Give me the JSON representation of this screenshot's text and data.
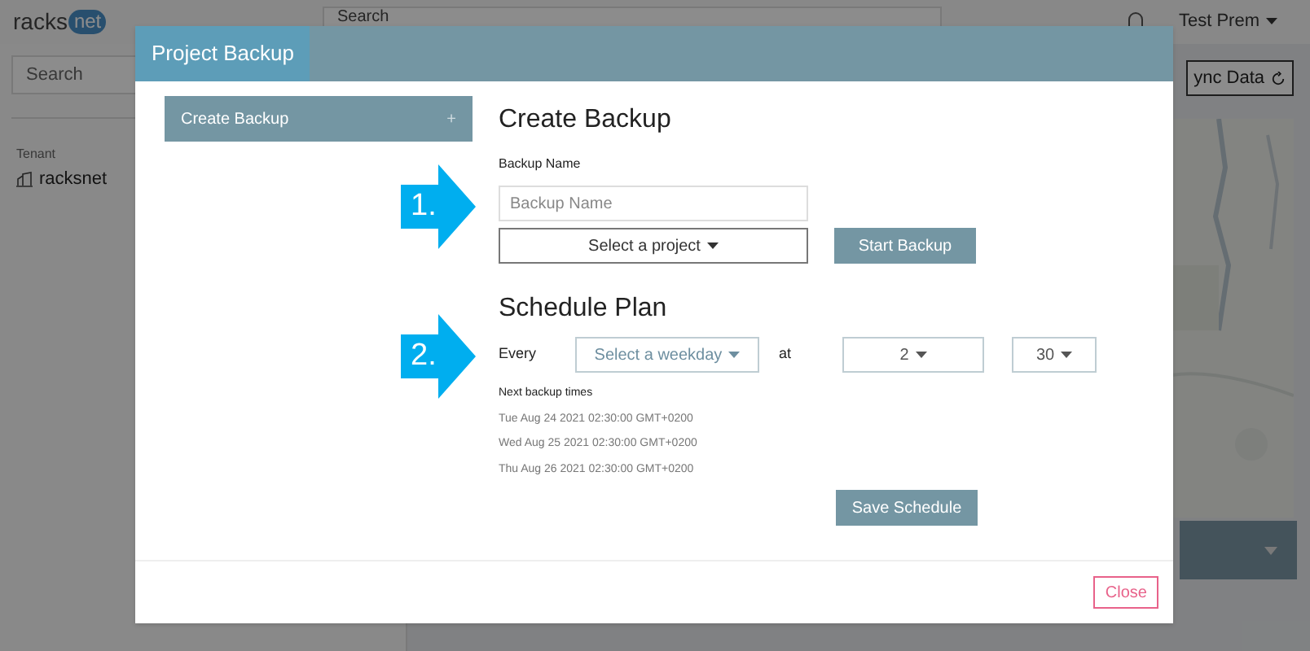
{
  "app": {
    "logo": {
      "text": "racks",
      "badge": "net"
    },
    "top_search": {
      "placeholder": "Search"
    },
    "user_menu": "Test Prem",
    "sidebar": {
      "search": {
        "placeholder": "Search"
      },
      "tenant_label": "Tenant",
      "tenant": "racksnet"
    },
    "sync_button": "ync Data"
  },
  "dialog": {
    "title": "Project Backup",
    "nav": [
      {
        "label": "Create Backup",
        "icon": "+",
        "selected": true
      }
    ],
    "create_backup": {
      "step": "1.",
      "heading": "Create Backup",
      "name_label": "Backup Name",
      "name_field": {
        "placeholder": "Backup Name"
      },
      "project_select": "Select a project",
      "start_button": "Start Backup"
    },
    "schedule": {
      "step": "2.",
      "heading": "Schedule Plan",
      "every_label": "Every",
      "weekday_select": "Select a weekday",
      "at_label": "at",
      "hour_select": "2",
      "minute_select": "30",
      "next_label": "Next backup times",
      "next_times": [
        "Tue Aug 24 2021 02:30:00 GMT+0200",
        "Wed Aug 25 2021 02:30:00 GMT+0200",
        "Thu Aug 26 2021 02:30:00 GMT+0200"
      ],
      "save_button": "Save Schedule"
    },
    "close_button": "Close"
  }
}
